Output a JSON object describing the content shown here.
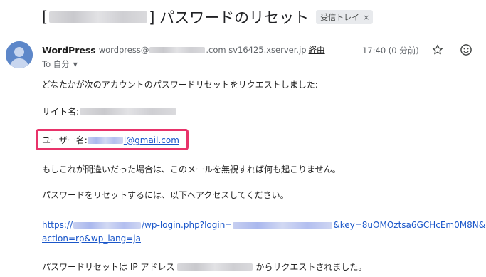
{
  "subject": {
    "prefix": "[",
    "suffix": "] パスワードのリセット",
    "label_badge": "受信トレイ",
    "badge_close": "×"
  },
  "sender": {
    "name": "WordPress",
    "email_prefix": "wordpress@",
    "email_suffix": ".com",
    "server": "sv16425.xserver.jp",
    "via_label": "経由",
    "time": "17:40 (0 分前)",
    "to_label": "To 自分"
  },
  "body": {
    "line1": "どなたかが次のアカウントのパスワードリセットをリクエストしました:",
    "site_label": "サイト名:",
    "user_label": "ユーザー名:",
    "user_email_suffix": "l@gmail.com",
    "ignore_notice": "もしこれが間違いだった場合は、このメールを無視すれば何も起こりません。",
    "reset_instructions": "パスワードをリセットするには、以下へアクセスしてください。",
    "url_part1": "https://",
    "url_part2": "/wp-login.php?login=",
    "url_part3": "&key=8uOMOztsa6GCHcEm0M8N&",
    "url_line2": "action=rp&wp_lang=ja",
    "ip_prefix": "パスワードリセットは IP アドレス",
    "ip_suffix": "からリクエストされました。"
  },
  "icons": {
    "avatar": "person-avatar-icon",
    "star": "star-icon",
    "emoji": "add-reaction-icon",
    "dropdown": "chevron-down-icon"
  },
  "colors": {
    "link": "#1a56c9",
    "highlight_box": "#e8336a",
    "avatar_bg": "#5d87c9"
  }
}
